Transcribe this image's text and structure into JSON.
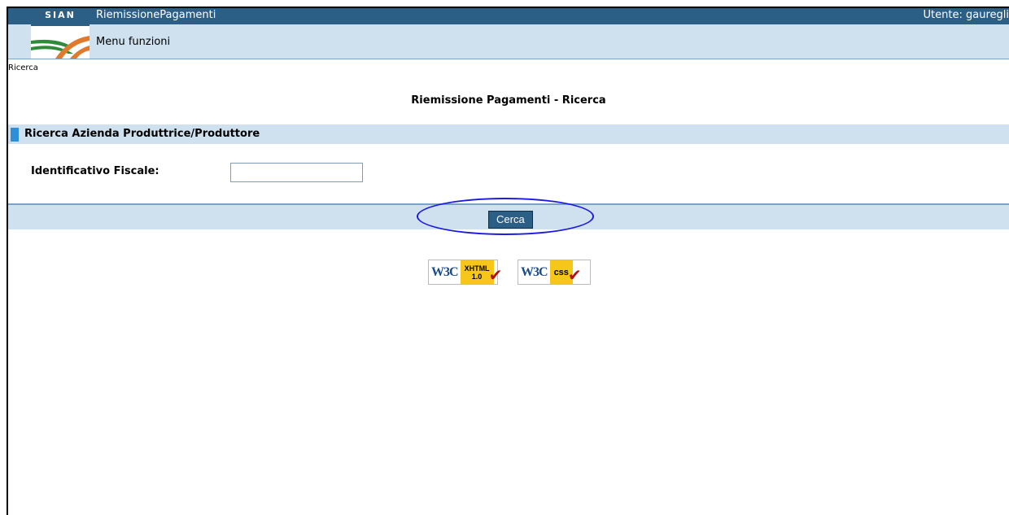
{
  "header": {
    "app_name": "RiemissionePagamenti",
    "user": "Utente: gauregli",
    "logo_text": "SIAN",
    "menu_label": "Menu funzioni"
  },
  "breadcrumb": "Ricerca",
  "page_title": "Riemissione Pagamenti - Ricerca",
  "section": {
    "title": "Ricerca Azienda Produttrice/Produttore"
  },
  "form": {
    "fiscal_id_label": "Identificativo Fiscale:",
    "fiscal_id_value": ""
  },
  "actions": {
    "search_label": "Cerca"
  },
  "badges": {
    "xhtml_left": "W3C",
    "xhtml_top": "XHTML",
    "xhtml_bottom": "1.0",
    "css_left": "W3C",
    "css_right": "css"
  },
  "colors": {
    "header_blue": "#2c5f86",
    "light_band": "#cfe0ee",
    "section_marker": "#2f8fd6",
    "annotation_ellipse": "#1a1ae0"
  }
}
